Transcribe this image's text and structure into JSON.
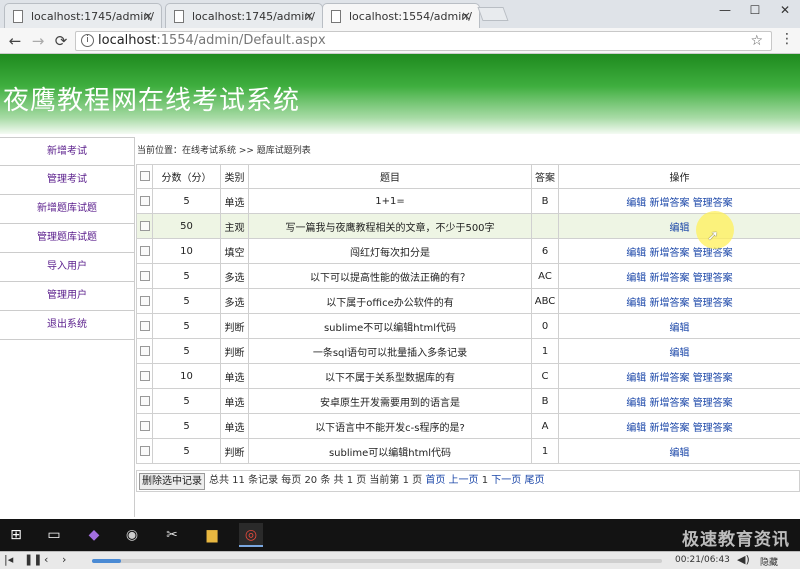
{
  "browser": {
    "tabs": [
      {
        "title": "localhost:1745/admin/",
        "close": "×"
      },
      {
        "title": "localhost:1745/admin/",
        "close": "×"
      },
      {
        "title": "localhost:1554/admin/",
        "close": "×"
      }
    ],
    "window_controls": {
      "minimize": "—",
      "maximize": "☐",
      "close": "✕"
    },
    "nav": {
      "back": "←",
      "forward": "→",
      "reload": "⟳"
    },
    "url_host": "localhost",
    "url_rest": ":1554/admin/Default.aspx",
    "info_glyph": "i",
    "star": "☆",
    "menu": "⋮"
  },
  "app": {
    "title": "夜鹰教程网在线考试系统",
    "banner_color": "#2f9a2f"
  },
  "sidebar": {
    "items": [
      {
        "label": "新增考试"
      },
      {
        "label": "管理考试"
      },
      {
        "label": "新增题库试题"
      },
      {
        "label": "管理题库试题"
      },
      {
        "label": "导入用户"
      },
      {
        "label": "管理用户"
      },
      {
        "label": "退出系统"
      }
    ]
  },
  "breadcrumb": "当前位置：在线考试系统 >> 题库试题列表",
  "table": {
    "headers": {
      "score": "分数（分）",
      "type": "类别",
      "question": "题目",
      "answer": "答案",
      "ops": "操作"
    },
    "rows": [
      {
        "score": "5",
        "type": "单选",
        "question": "1+1=",
        "answer": "B",
        "ops": [
          "编辑",
          "新增答案",
          "管理答案"
        ]
      },
      {
        "score": "50",
        "type": "主观",
        "question": "写一篇我与夜鹰教程相关的文章，不少于500字",
        "answer": "",
        "ops": [
          "编辑"
        ]
      },
      {
        "score": "10",
        "type": "填空",
        "question": "闯红灯每次扣分是",
        "answer": "6",
        "ops": [
          "编辑",
          "新增答案",
          "管理答案"
        ]
      },
      {
        "score": "5",
        "type": "多选",
        "question": "以下可以提高性能的做法正确的有？",
        "answer": "AC",
        "ops": [
          "编辑",
          "新增答案",
          "管理答案"
        ]
      },
      {
        "score": "5",
        "type": "多选",
        "question": "以下属于office办公软件的有",
        "answer": "ABC",
        "ops": [
          "编辑",
          "新增答案",
          "管理答案"
        ]
      },
      {
        "score": "5",
        "type": "判断",
        "question": "sublime不可以编辑html代码",
        "answer": "0",
        "ops": [
          "编辑"
        ]
      },
      {
        "score": "5",
        "type": "判断",
        "question": "一条sql语句可以批量插入多条记录",
        "answer": "1",
        "ops": [
          "编辑"
        ]
      },
      {
        "score": "10",
        "type": "单选",
        "question": "以下不属于关系型数据库的有",
        "answer": "C",
        "ops": [
          "编辑",
          "新增答案",
          "管理答案"
        ]
      },
      {
        "score": "5",
        "type": "单选",
        "question": "安卓原生开发需要用到的语言是",
        "answer": "B",
        "ops": [
          "编辑",
          "新增答案",
          "管理答案"
        ]
      },
      {
        "score": "5",
        "type": "单选",
        "question": "以下语言中不能开发c-s程序的是?",
        "answer": "A",
        "ops": [
          "编辑",
          "新增答案",
          "管理答案"
        ]
      },
      {
        "score": "5",
        "type": "判断",
        "question": "sublime可以编辑html代码",
        "answer": "1",
        "ops": [
          "编辑"
        ]
      }
    ]
  },
  "pager": {
    "delete_button": "删除选中记录",
    "summary": "总共 11 条记录 每页 20 条 共 1 页 当前第 1 页",
    "first": "首页",
    "prev": "上一页",
    "page": "1",
    "next": "下一页",
    "last": "尾页"
  },
  "taskbar": {
    "icons": [
      "windows-icon",
      "task-view-icon",
      "visual-studio-icon",
      "media-icon",
      "tool-icon",
      "folder-icon",
      "chrome-icon"
    ],
    "watermark": "极速教育资讯"
  },
  "player": {
    "time": "00:21/06:43",
    "hide_label": "隐藏",
    "progress": 0.05
  }
}
